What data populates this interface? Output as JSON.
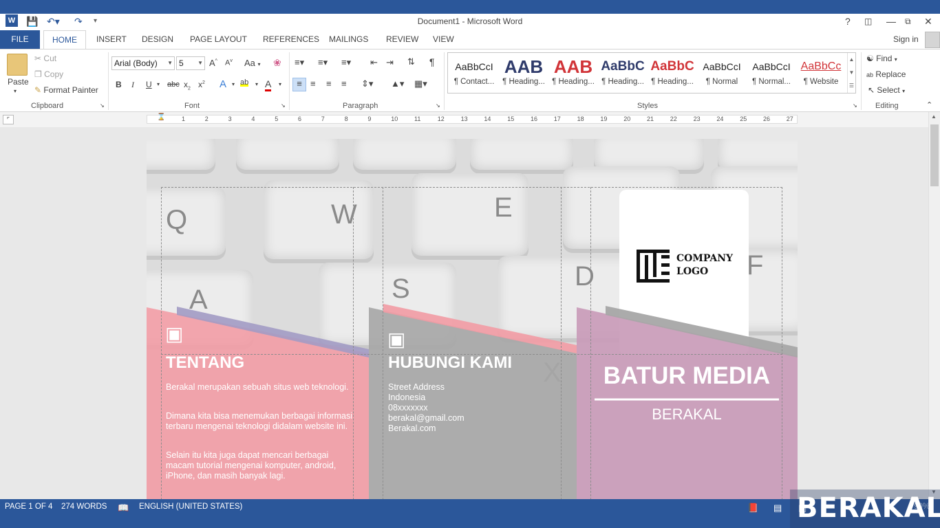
{
  "window": {
    "title": "Document1 - Microsoft Word",
    "help": "?",
    "signin": "Sign in"
  },
  "tabs": {
    "file": "FILE",
    "home": "HOME",
    "others": [
      "INSERT",
      "DESIGN",
      "PAGE LAYOUT",
      "REFERENCES",
      "MAILINGS",
      "REVIEW",
      "VIEW"
    ]
  },
  "clipboard": {
    "paste": "Paste",
    "cut": "Cut",
    "copy": "Copy",
    "format_painter": "Format Painter",
    "label": "Clipboard"
  },
  "font": {
    "family": "Arial (Body)",
    "size": "5",
    "label": "Font",
    "case": "Aa"
  },
  "paragraph": {
    "label": "Paragraph"
  },
  "styles": {
    "label": "Styles",
    "items": [
      {
        "preview": "AaBbCcI",
        "name": "¶ Contact...",
        "color": "#222222"
      },
      {
        "preview": "AAB",
        "name": "¶ Heading...",
        "color": "#2f3b6b"
      },
      {
        "preview": "AAB",
        "name": "¶ Heading...",
        "color": "#d13438"
      },
      {
        "preview": "AaBbC",
        "name": "¶ Heading...",
        "color": "#2f3b6b"
      },
      {
        "preview": "AaBbC",
        "name": "¶ Heading...",
        "color": "#d13438"
      },
      {
        "preview": "AaBbCcI",
        "name": "¶ Normal",
        "color": "#222222"
      },
      {
        "preview": "AaBbCcI",
        "name": "¶ Normal...",
        "color": "#222222"
      },
      {
        "preview": "AaBbCc",
        "name": "¶ Website",
        "color": "#d13438"
      }
    ]
  },
  "editing": {
    "find": "Find",
    "replace": "Replace",
    "select": "Select",
    "label": "Editing"
  },
  "ruler": [
    "1",
    "2",
    "3",
    "4",
    "5",
    "6",
    "7",
    "8",
    "9",
    "10",
    "11",
    "12",
    "13",
    "14",
    "15",
    "16",
    "17",
    "18",
    "19",
    "20",
    "21",
    "22",
    "23",
    "24",
    "25",
    "26",
    "27"
  ],
  "document": {
    "keys": [
      "Q",
      "W",
      "E",
      "A",
      "S",
      "D",
      "X",
      "F"
    ],
    "left_panel": {
      "title": "TENTANG",
      "p1": "Berakal merupakan sebuah situs web teknologi.",
      "p2": "Dimana kita bisa menemukan berbagai informasi terbaru mengenai teknologi didalam website ini.",
      "p3": "Selain itu kita juga dapat mencari berbagai macam tutorial mengenai komputer, android, iPhone, dan masih banyak lagi."
    },
    "middle_panel": {
      "title": "HUBUNGI KAMI",
      "lines": [
        "Street Address",
        "Indonesia",
        "08xxxxxxx",
        "berakal@gmail.com",
        "Berakal.com"
      ]
    },
    "right_panel": {
      "logo_line1": "COMPANY",
      "logo_line2": "LOGO",
      "brand": "BATUR MEDIA",
      "sub": "BERAKAL"
    },
    "colors": {
      "pink": "#f29ba4",
      "gray": "#a7a7a7",
      "purple": "#a29bc4"
    }
  },
  "status": {
    "page": "PAGE 1 OF 4",
    "words": "274 WORDS",
    "language": "ENGLISH (UNITED STATES)",
    "zoom": "90%"
  },
  "watermark": "BERAKAL"
}
